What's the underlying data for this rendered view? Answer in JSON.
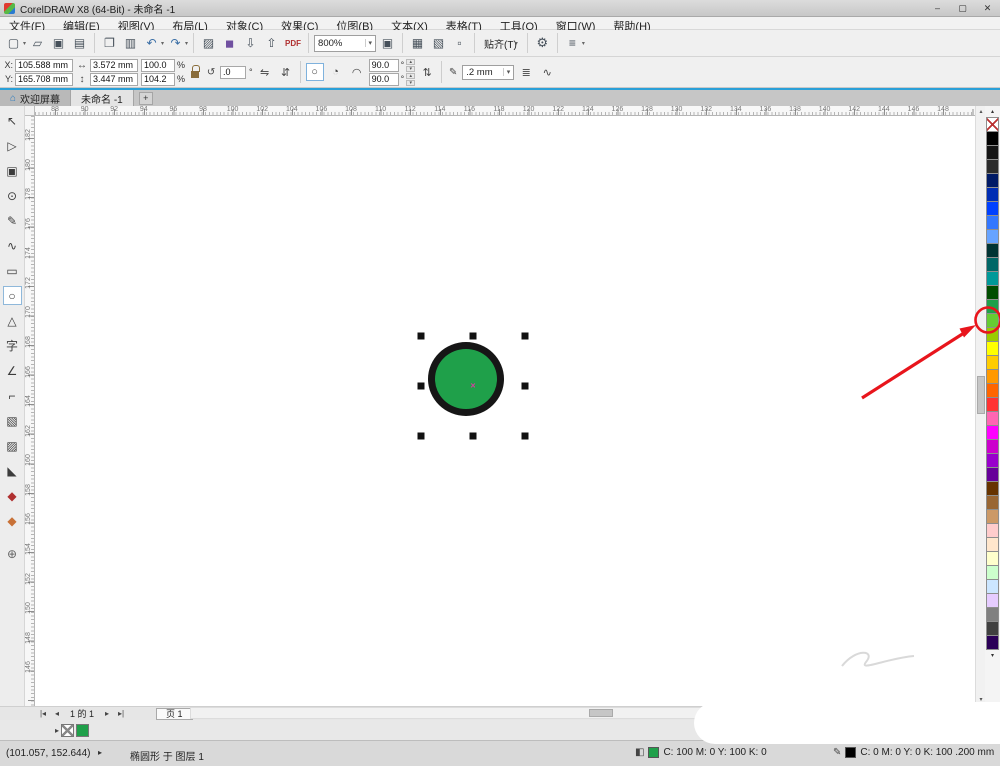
{
  "titlebar": {
    "title": "CorelDRAW X8 (64-Bit) - 未命名 -1"
  },
  "menus": [
    "文件(F)",
    "编辑(E)",
    "视图(V)",
    "布局(L)",
    "对象(C)",
    "效果(C)",
    "位图(B)",
    "文本(X)",
    "表格(T)",
    "工具(O)",
    "窗口(W)",
    "帮助(H)"
  ],
  "toolbar": {
    "zoom_value": "800%",
    "snap_label": "贴齐(T)",
    "pdf_label": "PDF"
  },
  "propbar": {
    "x_label": "X:",
    "x_value": "105.588 mm",
    "y_label": "Y:",
    "y_value": "165.708 mm",
    "width_value": "3.572 mm",
    "height_value": "3.447 mm",
    "scale_x": "100.0",
    "scale_y": "104.2",
    "percent": "%",
    "rotate_value": ".0",
    "degree": "°",
    "start_angle": "90.0",
    "end_angle": "90.0",
    "outline_width": ".2 mm"
  },
  "tabs": {
    "welcome": "欢迎屏幕",
    "doc": "未命名 -1",
    "add": "+"
  },
  "rulers": {
    "h": [
      "88",
      "90",
      "92",
      "94",
      "96",
      "98",
      "100",
      "102",
      "104",
      "106",
      "108",
      "110",
      "112",
      "114",
      "116",
      "118",
      "120",
      "122",
      "124",
      "126",
      "128",
      "130",
      "132",
      "134",
      "136",
      "138",
      "140",
      "142",
      "144",
      "146",
      "148"
    ],
    "v": [
      "182",
      "180",
      "178",
      "176",
      "174",
      "172",
      "170",
      "168",
      "166",
      "164",
      "162",
      "160",
      "158",
      "156",
      "154",
      "152",
      "150",
      "148",
      "146"
    ]
  },
  "toolbox": [
    {
      "name": "pick-tool",
      "glyph": "↖"
    },
    {
      "name": "shape-tool",
      "glyph": "▷"
    },
    {
      "name": "crop-tool",
      "glyph": "▣"
    },
    {
      "name": "zoom-tool",
      "glyph": "⊙"
    },
    {
      "name": "freehand-tool",
      "glyph": "✎"
    },
    {
      "name": "artistic-media-tool",
      "glyph": "∿"
    },
    {
      "name": "rectangle-tool",
      "glyph": "▭"
    },
    {
      "name": "ellipse-tool",
      "glyph": "○",
      "active": true
    },
    {
      "name": "polygon-tool",
      "glyph": "△"
    },
    {
      "name": "text-tool",
      "glyph": "字"
    },
    {
      "name": "parallel-dimension-tool",
      "glyph": "∠"
    },
    {
      "name": "connector-tool",
      "glyph": "⌐"
    },
    {
      "name": "drop-shadow-tool",
      "glyph": "▧"
    },
    {
      "name": "transparency-tool",
      "glyph": "▨"
    },
    {
      "name": "color-eyedropper-tool",
      "glyph": "◣"
    },
    {
      "name": "outline-pen-tool",
      "glyph": "◆"
    },
    {
      "name": "fill-tool",
      "glyph": "◆"
    },
    {
      "name": "add-tool-button",
      "glyph": "⊕"
    }
  ],
  "palette": {
    "colors": [
      "none",
      "#000000",
      "#141414",
      "#2b2b2b",
      "#001a66",
      "#002db3",
      "#0040ff",
      "#3377ff",
      "#66a3ff",
      "#003333",
      "#006666",
      "#009999",
      "#004d00",
      "#1fa04a",
      "#66cc33",
      "#99cc00",
      "#ffff00",
      "#ffcc00",
      "#ff9900",
      "#ff6600",
      "#ff3333",
      "#ff66b3",
      "#ff00ff",
      "#cc00cc",
      "#9900cc",
      "#660099",
      "#663300",
      "#996633",
      "#cc9966",
      "#ffcccc",
      "#ffe6cc",
      "#ffffcc",
      "#ccffcc",
      "#cce6ff",
      "#e6ccff",
      "#808080",
      "#404040",
      "#2b0057"
    ],
    "highlight_index": 13
  },
  "doc_palette": {
    "color": "#1fa04a"
  },
  "canvas": {
    "circle": {
      "fill": "#1fa04a",
      "stroke": "#161616"
    },
    "center_glyph": "×"
  },
  "pagenav": {
    "first": "|◂",
    "prev": "◂",
    "info": "1 的 1",
    "next": "▸",
    "last": "▸|",
    "tab": "页 1"
  },
  "statusbar": {
    "coords": "(101.057, 152.644)",
    "object_info": "椭圆形 于 图层 1",
    "fill_label": "C: 100 M: 0 Y: 100 K: 0",
    "fill_color": "#1fa04a",
    "outline_label": "C: 0 M: 0 Y: 0 K: 100 .200 mm",
    "outline_color": "#000000"
  },
  "annotation": {
    "color": "#e8151c"
  },
  "icons": {
    "minimize": "–",
    "maximize": "▢",
    "close": "✕",
    "new_doc": "▢",
    "caret": "▾",
    "open": "▱",
    "save": "▣",
    "print": "▤",
    "copy": "❐",
    "paste": "▥",
    "undo": "↶",
    "redo": "↷",
    "search": "▨",
    "welcome": "◼",
    "import": "⇩",
    "export": "⇧",
    "fullscreen": "▣",
    "view_pages": "▦",
    "view_grid": "▧",
    "draw_box": "▫",
    "gear": "⚙",
    "customize": "≡",
    "home": "⌂",
    "size_h": "↔",
    "size_v": "↕",
    "rotate": "↺",
    "mirror_h": "⇋",
    "mirror_v": "⇵",
    "ellipse_shape": "○",
    "pie_shape": "◔",
    "arc_shape": "◠",
    "spin_up": "▴",
    "spin_down": "▾",
    "swap": "⇅",
    "outline_pen": "✎",
    "wrap": "≣",
    "curves": "∿",
    "flyout": "▸",
    "fill_status": "◧",
    "outline_status": "✎",
    "scroll_up": "▴",
    "scroll_down": "▾",
    "pal_up": "▴",
    "pal_down": "▾"
  }
}
